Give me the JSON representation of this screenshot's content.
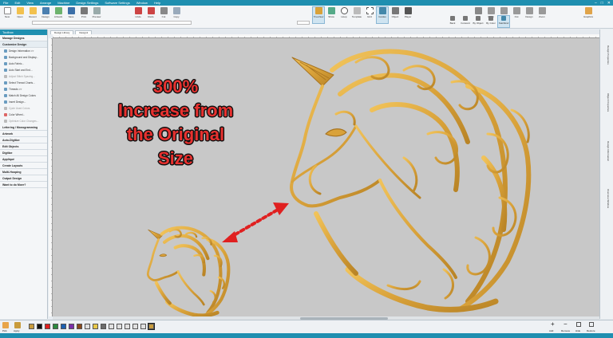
{
  "menu": [
    "File",
    "Edit",
    "View",
    "Arrange",
    "Machine",
    "Design Settings",
    "Software Settings",
    "Window",
    "Help"
  ],
  "ribbon": {
    "left": [
      "New",
      "Open",
      "Recent",
      "Design",
      "Artwork",
      "Save",
      "Print",
      "Preview",
      "Undo",
      "Redo",
      "Cut",
      "Copy",
      "Paste"
    ],
    "center": [
      "TrueView",
      "Show",
      "Hoop",
      "Template",
      "Grid",
      "Guides",
      "Object",
      "Player"
    ],
    "right": [
      "Pan",
      "100%",
      "Fit",
      "Out",
      "Design",
      "Zoom",
      "Graphics"
    ],
    "row2": [
      "Back",
      "Forward",
      "By Object",
      "By Color",
      "Start/End"
    ]
  },
  "toolbox": {
    "title": "Toolbox",
    "sections": [
      {
        "label": "Manage Designs",
        "open": false
      },
      {
        "label": "Customize Design",
        "open": true,
        "items": [
          {
            "label": "Design Information >>",
            "dim": false
          },
          {
            "label": "Background and Display...",
            "dim": false
          },
          {
            "label": "Auto Fabric...",
            "dim": false
          },
          {
            "label": "Auto Start and End...",
            "dim": false
          },
          {
            "label": "Adjust Stitch Spacing...",
            "dim": true
          },
          {
            "label": "Select Thread Charts...",
            "dim": false
          },
          {
            "label": "Threads >>",
            "dim": false
          },
          {
            "label": "Match All Design Colors",
            "dim": false
          },
          {
            "label": "Insert Design...",
            "dim": false
          },
          {
            "label": "Cycle Used Colors",
            "dim": true
          },
          {
            "label": "Color Wheel...",
            "dim": false
          },
          {
            "label": "Optimize Color Changes...",
            "dim": true
          }
        ]
      },
      {
        "label": "Lettering / Monogramming",
        "open": false
      },
      {
        "label": "Artwork",
        "open": false
      },
      {
        "label": "Auto-Digitize",
        "open": false
      },
      {
        "label": "Edit Objects",
        "open": false
      },
      {
        "label": "Digitize",
        "open": false
      },
      {
        "label": "Appliqué",
        "open": false
      },
      {
        "label": "Create Layouts",
        "open": false
      },
      {
        "label": "Multi-Hooping",
        "open": false
      },
      {
        "label": "Output Design",
        "open": false
      },
      {
        "label": "Want to do More?",
        "open": false
      }
    ]
  },
  "tabs": [
    "Design Library",
    "Design1"
  ],
  "right_tabs": [
    "Design Properties",
    "Object Properties",
    "Design Information",
    "Overview Window"
  ],
  "overlay_text": [
    "300%",
    "Increase from",
    "the Original",
    "Size"
  ],
  "colors": {
    "accent": "#1f8fb0",
    "embroidery_gold": "#d9a23a",
    "embroidery_shadow": "#a87420",
    "overlay_red": "#e8312f",
    "arrow_red": "#e02020"
  },
  "thread_swatches": [
    "#c89b3c",
    "#111111",
    "#e02020",
    "#2b8a3e",
    "#1b5fb0",
    "#7b2fa8",
    "#8a4a1c",
    "#e0e0e0",
    "#e8c84a",
    "#6c6c6c"
  ],
  "bottom_labels": [
    "Pick",
    "Apply",
    "Add",
    "Remove",
    "Hide",
    "Restore"
  ],
  "status": {
    "left": "",
    "mid": "",
    "right": ""
  }
}
